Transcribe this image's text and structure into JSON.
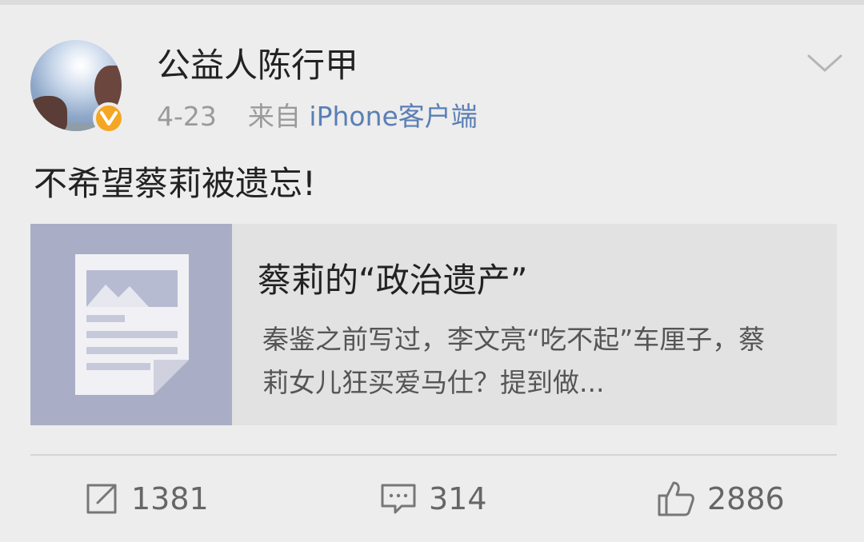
{
  "post": {
    "author": {
      "name": "公益人陈行甲",
      "verified_badge_icon": "verified-v-icon",
      "avatar_icon": "avatar-image"
    },
    "date": "4-23",
    "source_prefix": "来自",
    "source": "iPhone客户端",
    "menu_icon": "chevron-down-icon",
    "text": "不希望蔡莉被遗忘!"
  },
  "link_card": {
    "thumbnail_icon": "article-document-icon",
    "title": "蔡莉的“政治遗产”",
    "summary": "秦鉴之前写过，李文亮“吃不起”车厘子，蔡莉女儿狂买爱马仕？提到做..."
  },
  "actions": {
    "repost": {
      "icon": "repost-icon",
      "count": "1381"
    },
    "comment": {
      "icon": "comment-icon",
      "count": "314"
    },
    "like": {
      "icon": "thumbs-up-icon",
      "count": "2886"
    }
  },
  "colors": {
    "background": "#ededed",
    "link_blue": "#5a7fb5",
    "verified_badge": "#f5a623",
    "thumbnail_bg": "#a9aec6"
  }
}
